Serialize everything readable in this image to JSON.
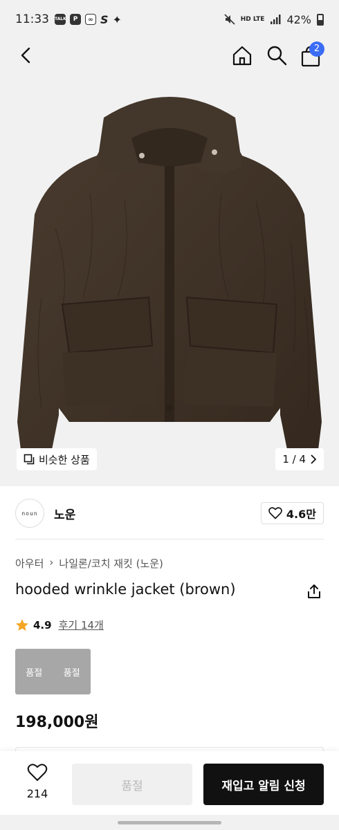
{
  "status_bar": {
    "time": "11:33",
    "left_icons": [
      "TALK",
      "P",
      "∞",
      "S",
      "✦"
    ],
    "network": "HD LTE",
    "battery": "42%"
  },
  "header": {
    "cart_count": "2"
  },
  "hero": {
    "similar_label": "비슷한 상품",
    "pager": "1 / 4"
  },
  "brand": {
    "logo_text": "noun",
    "name": "노운",
    "likes": "4.6만"
  },
  "product": {
    "breadcrumb": [
      "아우터",
      "나일론/코치 재킷 (노운)"
    ],
    "title": "hooded wrinkle jacket (brown)",
    "rating": "4.9",
    "reviews": "후기 14개",
    "options": [
      "품절",
      "품절"
    ],
    "price": "198,000원"
  },
  "bottom_bar": {
    "wish_count": "214",
    "soldout_label": "품절",
    "restock_label": "재입고 알림 신청"
  },
  "colors": {
    "accent": "#3b6cf6",
    "jacket": "#3f3328",
    "star": "#f5a623"
  }
}
